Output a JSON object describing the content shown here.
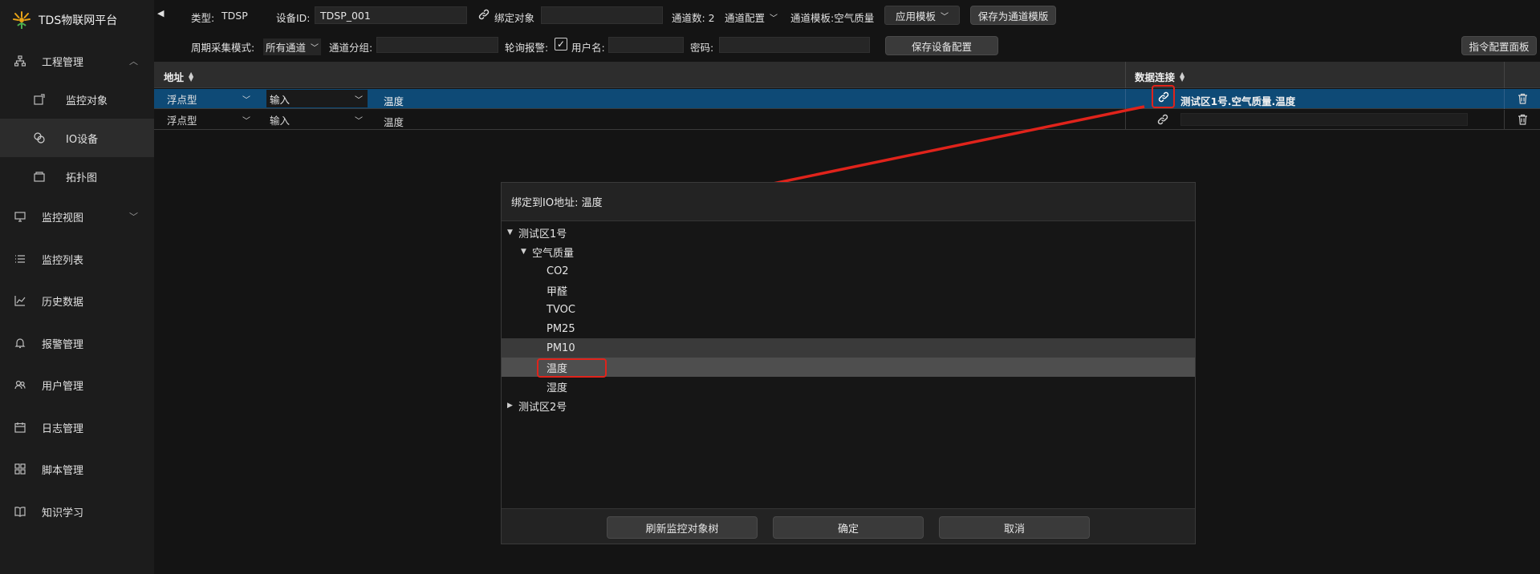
{
  "app": {
    "title": "TDS物联网平台"
  },
  "sidebar": {
    "items": [
      {
        "label": "工程管理",
        "icon": "sitemap-icon"
      },
      {
        "label": "监控对象",
        "icon": "object-icon"
      },
      {
        "label": "IO设备",
        "icon": "io-device-icon"
      },
      {
        "label": "拓扑图",
        "icon": "topology-icon"
      },
      {
        "label": "监控视图",
        "icon": "monitor-icon"
      },
      {
        "label": "监控列表",
        "icon": "list-icon"
      },
      {
        "label": "历史数据",
        "icon": "chart-line-icon"
      },
      {
        "label": "报警管理",
        "icon": "bell-icon"
      },
      {
        "label": "用户管理",
        "icon": "users-icon"
      },
      {
        "label": "日志管理",
        "icon": "calendar-icon"
      },
      {
        "label": "脚本管理",
        "icon": "grid-icon"
      },
      {
        "label": "知识学习",
        "icon": "book-icon"
      }
    ]
  },
  "toolbar": {
    "type_label": "类型:",
    "type_value": "TDSP",
    "device_id_label": "设备ID:",
    "device_id_value": "TDSP_001",
    "bind_object_label": "绑定对象",
    "channel_count_label": "通道数: 2",
    "channel_config_label": "通道配置",
    "channel_template_label": "通道模板:空气质量",
    "apply_template_label": "应用模板",
    "save_as_template_label": "保存为通道模版",
    "period_mode_label": "周期采集模式:",
    "period_mode_value": "所有通道",
    "channel_group_label": "通道分组:",
    "poll_alarm_label": "轮询报警:",
    "username_label": "用户名:",
    "password_label": "密码:",
    "save_device_config_label": "保存设备配置",
    "command_panel_label": "指令配置面板"
  },
  "table": {
    "col_address": "地址",
    "col_data_link": "数据连接",
    "rows": [
      {
        "type": "浮点型",
        "direction": "输入",
        "name": "温度",
        "link": "测试区1号.空气质量.温度"
      },
      {
        "type": "浮点型",
        "direction": "输入",
        "name": "温度",
        "link": ""
      }
    ]
  },
  "dialog": {
    "title": "绑定到IO地址:  温度",
    "tree": [
      {
        "label": "测试区1号",
        "level": 0,
        "expanded": true
      },
      {
        "label": "空气质量",
        "level": 1,
        "expanded": true
      },
      {
        "label": "CO2",
        "level": 2
      },
      {
        "label": "甲醛",
        "level": 2
      },
      {
        "label": "TVOC",
        "level": 2
      },
      {
        "label": "PM25",
        "level": 2
      },
      {
        "label": "PM10",
        "level": 2
      },
      {
        "label": "温度",
        "level": 2
      },
      {
        "label": "湿度",
        "level": 2
      },
      {
        "label": "测试区2号",
        "level": 0,
        "expanded": false
      }
    ],
    "refresh_label": "刷新监控对象树",
    "ok_label": "确定",
    "cancel_label": "取消"
  },
  "colors": {
    "accent": "#0e4a76",
    "highlight_red": "#e0231b",
    "background": "#141414"
  }
}
